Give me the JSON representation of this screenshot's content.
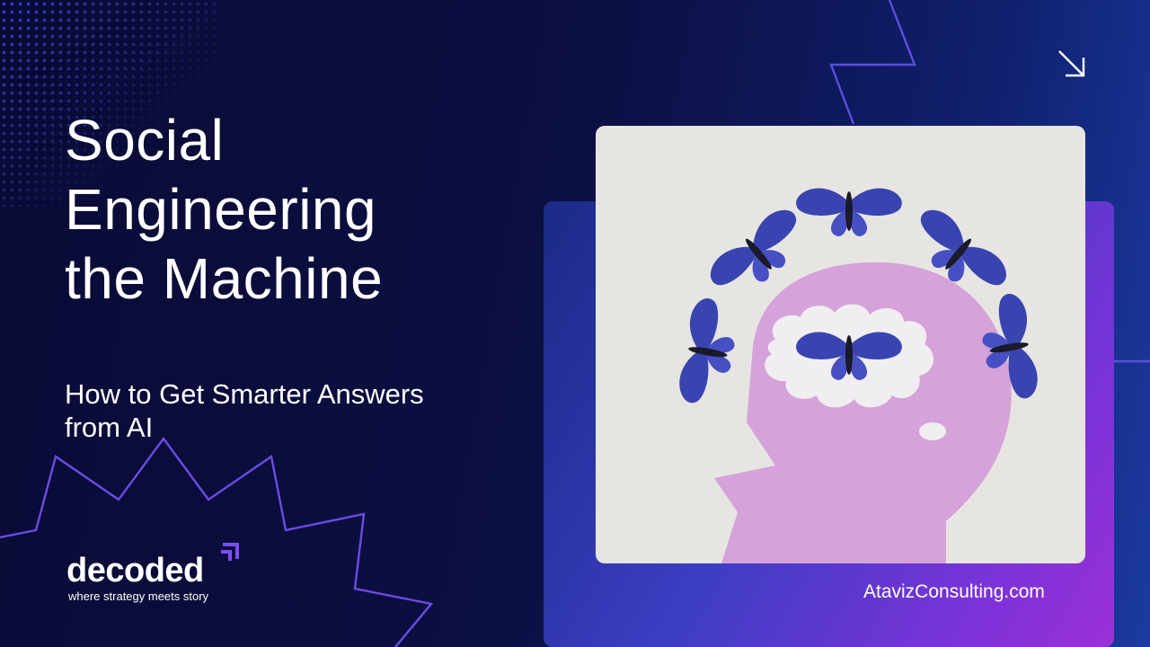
{
  "slide": {
    "title_lines": [
      "Social",
      "Engineering",
      "the Machine"
    ],
    "subtitle_lines": [
      "How to Get Smarter Answers",
      "from AI"
    ],
    "website": "AtavizConsulting.com"
  },
  "logo": {
    "wordmark": "decoded",
    "tagline": "where strategy meets story"
  },
  "icons": {
    "corner_arrow": "arrow-down-right-icon",
    "logo_mark": "double-chevron-icon"
  },
  "colors": {
    "background": "#0a0a35",
    "accent_line": "#5b4ee0",
    "panel_gradient_end": "#9b30d6",
    "head_silhouette": "#d5a2d9",
    "butterfly": "#3a44b0"
  }
}
